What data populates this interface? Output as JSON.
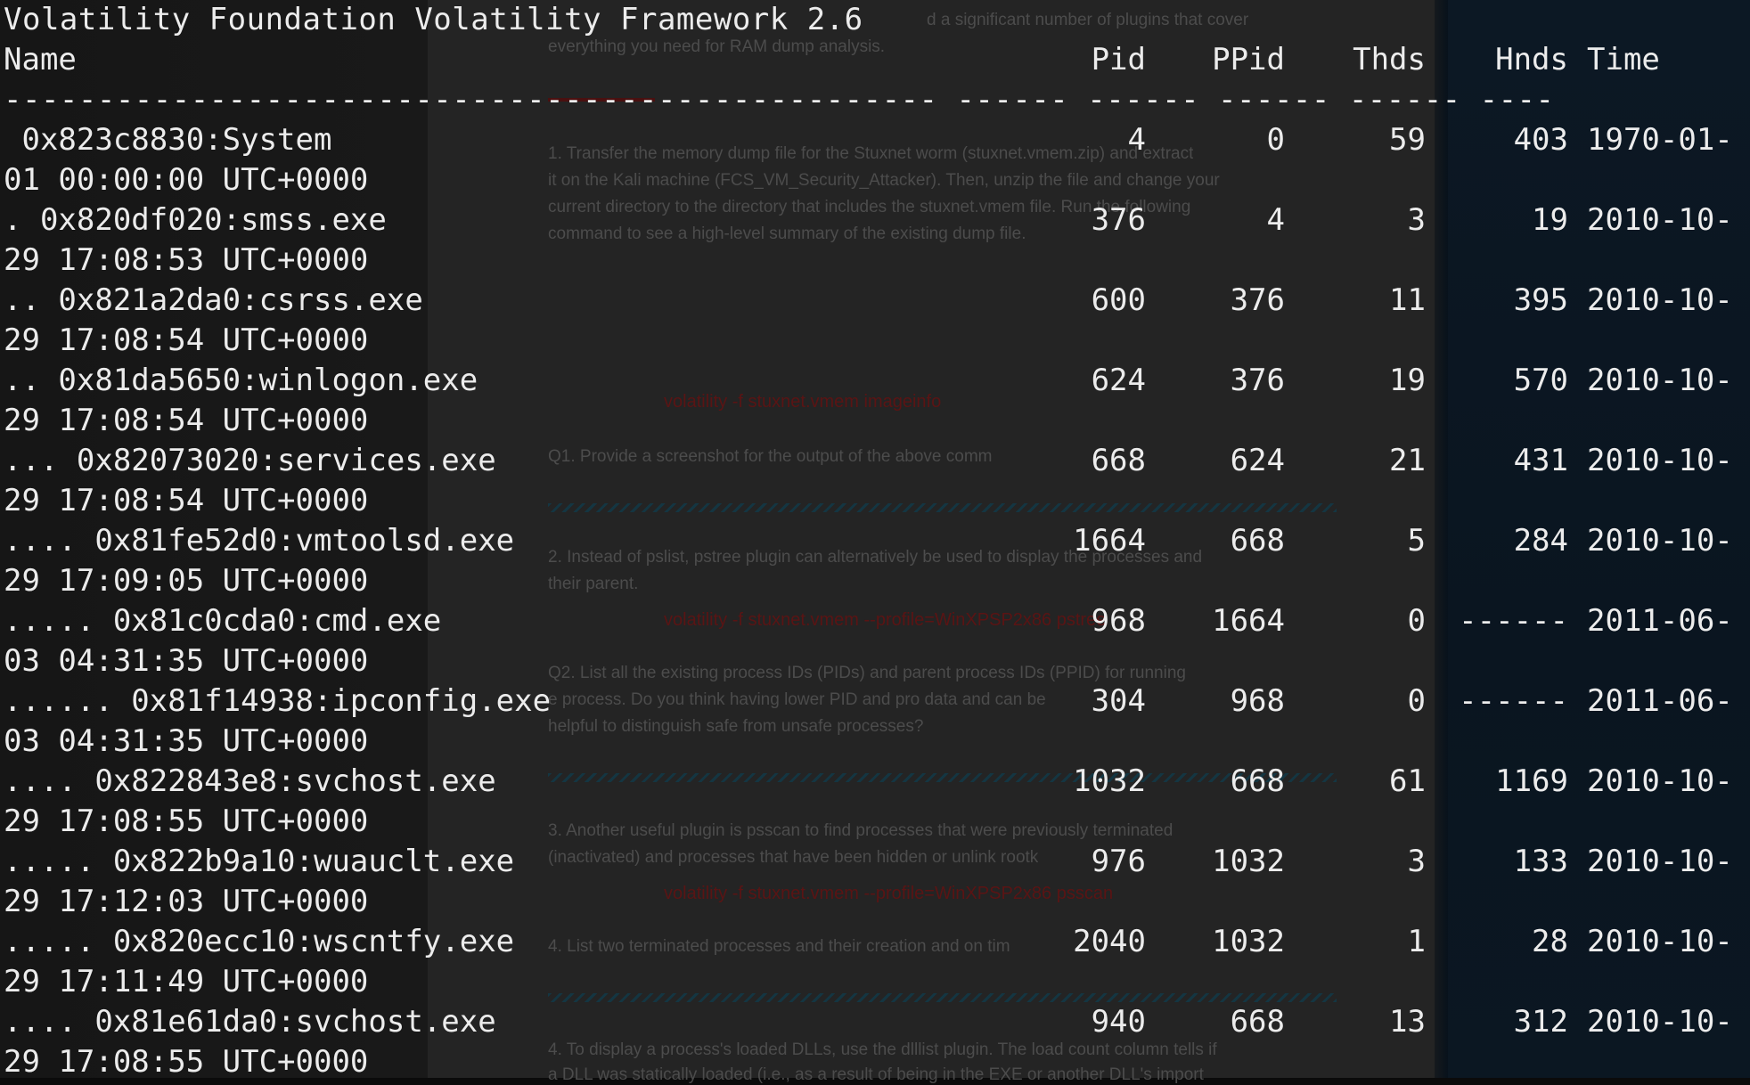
{
  "header_line": "Volatility Foundation Volatility Framework 2.6",
  "columns": {
    "name": "Name",
    "pid": "Pid",
    "ppid": "PPid",
    "thds": "Thds",
    "hnds": "Hnds",
    "time": "Time"
  },
  "separator": "-------------------------------------------------- ------ ------ ------ ------ ----",
  "rows": [
    {
      "name": " 0x823c8830:System",
      "pid": "4",
      "ppid": "0",
      "thds": "59",
      "hnds": "403",
      "time": "1970-01-",
      "time_cont": "01 00:00:00 UTC+0000"
    },
    {
      "name": ". 0x820df020:smss.exe",
      "pid": "376",
      "ppid": "4",
      "thds": "3",
      "hnds": "19",
      "time": "2010-10-",
      "time_cont": "29 17:08:53 UTC+0000"
    },
    {
      "name": ".. 0x821a2da0:csrss.exe",
      "pid": "600",
      "ppid": "376",
      "thds": "11",
      "hnds": "395",
      "time": "2010-10-",
      "time_cont": "29 17:08:54 UTC+0000"
    },
    {
      "name": ".. 0x81da5650:winlogon.exe",
      "pid": "624",
      "ppid": "376",
      "thds": "19",
      "hnds": "570",
      "time": "2010-10-",
      "time_cont": "29 17:08:54 UTC+0000"
    },
    {
      "name": "... 0x82073020:services.exe",
      "pid": "668",
      "ppid": "624",
      "thds": "21",
      "hnds": "431",
      "time": "2010-10-",
      "time_cont": "29 17:08:54 UTC+0000"
    },
    {
      "name": ".... 0x81fe52d0:vmtoolsd.exe",
      "pid": "1664",
      "ppid": "668",
      "thds": "5",
      "hnds": "284",
      "time": "2010-10-",
      "time_cont": "29 17:09:05 UTC+0000"
    },
    {
      "name": "..... 0x81c0cda0:cmd.exe",
      "pid": "968",
      "ppid": "1664",
      "thds": "0",
      "hnds": "------",
      "time": "2011-06-",
      "time_cont": "03 04:31:35 UTC+0000"
    },
    {
      "name": "...... 0x81f14938:ipconfig.exe",
      "pid": "304",
      "ppid": "968",
      "thds": "0",
      "hnds": "------",
      "time": "2011-06-",
      "time_cont": "03 04:31:35 UTC+0000"
    },
    {
      "name": ".... 0x822843e8:svchost.exe",
      "pid": "1032",
      "ppid": "668",
      "thds": "61",
      "hnds": "1169",
      "time": "2010-10-",
      "time_cont": "29 17:08:55 UTC+0000"
    },
    {
      "name": "..... 0x822b9a10:wuauclt.exe",
      "pid": "976",
      "ppid": "1032",
      "thds": "3",
      "hnds": "133",
      "time": "2010-10-",
      "time_cont": "29 17:12:03 UTC+0000"
    },
    {
      "name": "..... 0x820ecc10:wscntfy.exe",
      "pid": "2040",
      "ppid": "1032",
      "thds": "1",
      "hnds": "28",
      "time": "2010-10-",
      "time_cont": "29 17:11:49 UTC+0000"
    },
    {
      "name": ".... 0x81e61da0:svchost.exe",
      "pid": "940",
      "ppid": "668",
      "thds": "13",
      "hnds": "312",
      "time": "2010-10-",
      "time_cont": "29 17:08:55 UTC+0000"
    }
  ],
  "background_document": {
    "paragraphs": [
      "d a significant number of plugins that cover",
      "everything you need for RAM dump analysis.",
      "1. Transfer the memory dump file for the Stuxnet worm (stuxnet.vmem.zip) and extract",
      "it on the Kali machine (FCS_VM_Security_Attacker). Then, unzip the file and change your",
      "current directory to the directory that includes the stuxnet.vmem file. Run the following",
      "command to see a high-level summary of the existing dump file.",
      "Q1. Provide a screenshot for the output of the above comm",
      "2. Instead of pslist, pstree plugin can alternatively be used to display the processes and",
      "their parent.",
      "Q2. List all the existing process IDs (PIDs) and parent process IDs (PPID) for running",
      "e process. Do you think having lower PID and pro     data and     can be",
      "helpful to distinguish safe from unsafe processes?",
      "3. Another useful plugin is psscan to find processes that were previously terminated",
      "(inactivated) and processes that have been hidden or unlink     rootk",
      "4. List two terminated processes and their creation and     on tim",
      "4. To display a process's loaded DLLs, use the dlllist plugin. The load count column tells if",
      "a DLL was statically loaded (i.e., as a result of being in the EXE or another DLL's import"
    ],
    "commands": [
      "volatility -f stuxnet.vmem imageinfo",
      "volatility -f stuxnet.vmem --profile=WinXPSP2x86 pstree",
      "volatility -f stuxnet.vmem --profile=WinXPSP2x86 psscan"
    ]
  }
}
